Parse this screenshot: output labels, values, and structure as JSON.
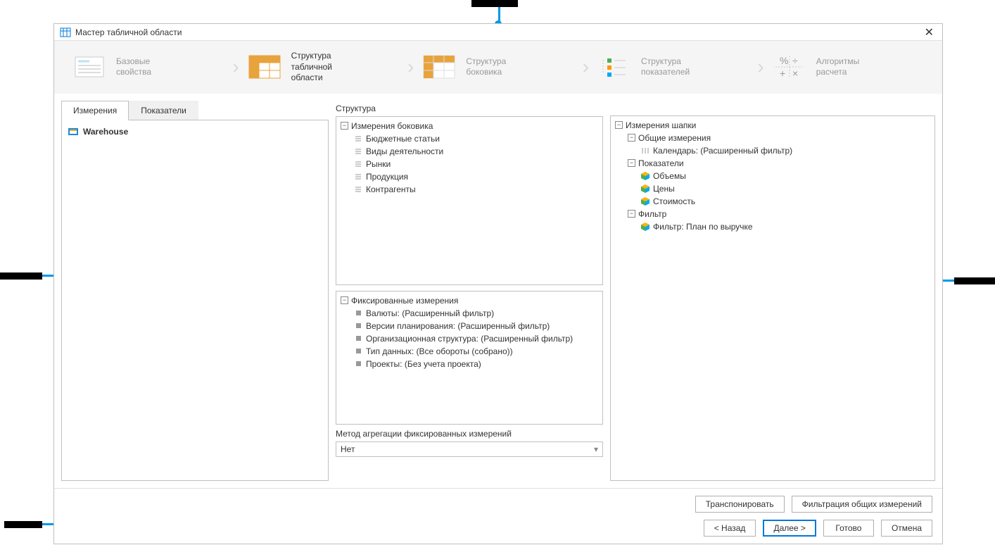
{
  "window": {
    "title": "Мастер табличной области"
  },
  "steps": [
    {
      "line1": "Базовые",
      "line2": "свойства"
    },
    {
      "line1": "Структура",
      "line2": "табличной",
      "line3": "области"
    },
    {
      "line1": "Структура",
      "line2": "боковика"
    },
    {
      "line1": "Структура",
      "line2": "показателей"
    },
    {
      "line1": "Алгоритмы",
      "line2": "расчета"
    }
  ],
  "left": {
    "tab_measurements": "Измерения",
    "tab_indicators": "Показатели",
    "warehouse": "Warehouse"
  },
  "mid": {
    "heading": "Структура",
    "group_side": "Измерения боковика",
    "side_items": [
      "Бюджетные статьи",
      "Виды деятельности",
      "Рынки",
      "Продукция",
      "Контрагенты"
    ],
    "group_fixed": "Фиксированные измерения",
    "fixed_items": [
      "Валюты: (Расширенный фильтр)",
      "Версии планирования: (Расширенный фильтр)",
      "Организационная структура: (Расширенный фильтр)",
      "Тип данных: (Все обороты (собрано))",
      "Проекты: (Без учета проекта)"
    ],
    "agg_label": "Метод агрегации фиксированных измерений",
    "agg_value": "Нет"
  },
  "right": {
    "group_header": "Измерения шапки",
    "group_common": "Общие измерения",
    "calendar": "Календарь: (Расширенный фильтр)",
    "group_indicators": "Показатели",
    "indicators": [
      "Объемы",
      "Цены",
      "Стоимость"
    ],
    "group_filter": "Фильтр",
    "filter_item": "Фильтр: План по выручке"
  },
  "footer": {
    "transpose": "Транспонировать",
    "filter_common": "Фильтрация общих измерений",
    "back": "< Назад",
    "next": "Далее >",
    "finish": "Готово",
    "cancel": "Отмена"
  }
}
